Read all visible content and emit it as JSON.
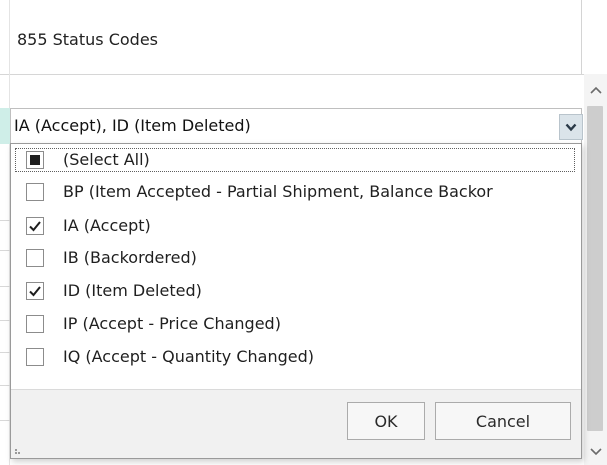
{
  "grid": {
    "column_header": "855 Status Codes"
  },
  "combo": {
    "value": "IA (Accept), ID (Item Deleted)"
  },
  "dropdown": {
    "items": [
      {
        "label": "(Select All)",
        "state": "indeterminate"
      },
      {
        "label": "BP (Item Accepted - Partial Shipment, Balance Backor",
        "state": "unchecked"
      },
      {
        "label": "IA (Accept)",
        "state": "checked"
      },
      {
        "label": "IB (Backordered)",
        "state": "unchecked"
      },
      {
        "label": "ID (Item Deleted)",
        "state": "checked"
      },
      {
        "label": "IP (Accept - Price Changed)",
        "state": "unchecked"
      },
      {
        "label": "IQ (Accept - Quantity Changed)",
        "state": "unchecked"
      }
    ],
    "ok_label": "OK",
    "cancel_label": "Cancel"
  },
  "icons": {
    "dropdown_button": "chevron-down-icon",
    "scroll_up": "scroll-up-icon",
    "scroll_down": "scroll-down-icon",
    "checkmark": "check-icon",
    "resize_grip": "resize-grip-icon"
  },
  "colors": {
    "row_accent": "#cfeee8",
    "combo_button": "#dbe4ea"
  }
}
